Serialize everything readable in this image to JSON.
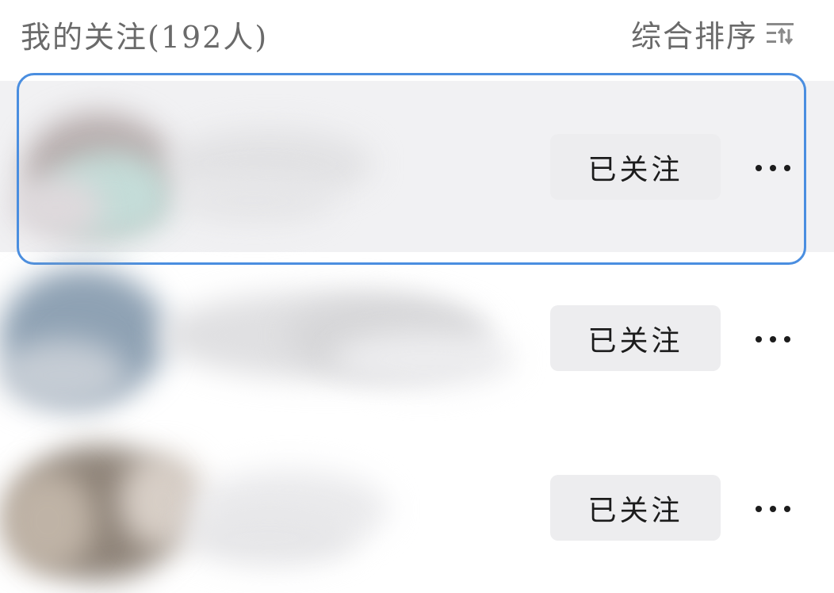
{
  "header": {
    "title": "我的关注(192人)",
    "sort_label": "综合排序",
    "sort_icon": "sort-filter-icon"
  },
  "rows": [
    {
      "follow_label": "已关注",
      "more_icon": "more-dots-icon",
      "highlighted": true
    },
    {
      "follow_label": "已关注",
      "more_icon": "more-dots-icon",
      "highlighted": false
    },
    {
      "follow_label": "已关注",
      "more_icon": "more-dots-icon",
      "highlighted": false
    }
  ],
  "colors": {
    "highlight_border": "#4a8ee0",
    "highlight_background": "#f1f1f3",
    "button_background": "#ededef",
    "header_text": "#6a6a6a"
  }
}
